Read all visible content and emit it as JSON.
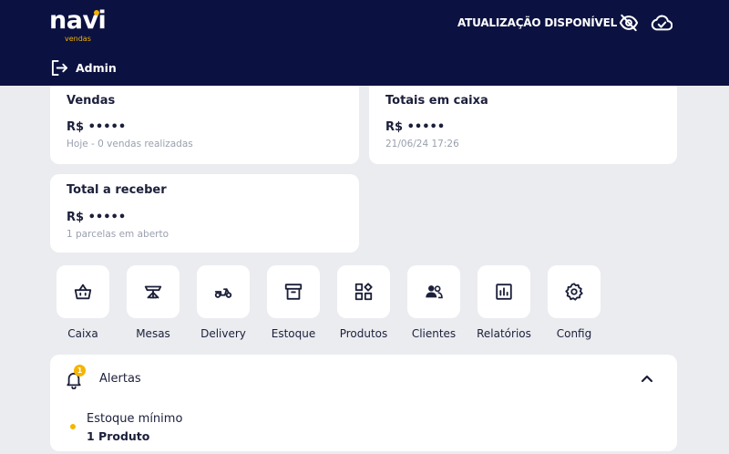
{
  "header": {
    "logo_main": "navi",
    "logo_sub": "vendas",
    "update_label": "ATUALIZAÇÃO DISPONÍVEL",
    "user_name": "Admin",
    "icons": [
      "eye-off-icon",
      "cloud-check-icon",
      "logout-icon"
    ],
    "colors": {
      "background": "#0b1140",
      "accent": "#f2b200"
    }
  },
  "cards": {
    "vendas": {
      "title": "Vendas",
      "value": "R$ •••••",
      "sub": "Hoje - 0 vendas realizadas"
    },
    "caixa": {
      "title": "Totais em caixa",
      "value": "R$ •••••",
      "sub": "21/06/24 17:26"
    },
    "receber": {
      "title": "Total a receber",
      "value": "R$ •••••",
      "sub": "1 parcelas em aberto"
    }
  },
  "shortcuts": [
    {
      "label": "Caixa",
      "icon": "basket-icon"
    },
    {
      "label": "Mesas",
      "icon": "table-icon"
    },
    {
      "label": "Delivery",
      "icon": "scooter-icon"
    },
    {
      "label": "Estoque",
      "icon": "archive-box-icon"
    },
    {
      "label": "Produtos",
      "icon": "grid-add-icon"
    },
    {
      "label": "Clientes",
      "icon": "people-icon"
    },
    {
      "label": "Relatórios",
      "icon": "report-icon"
    },
    {
      "label": "Config",
      "icon": "gear-icon"
    }
  ],
  "alerts": {
    "title": "Alertas",
    "badge_count": "1",
    "items": [
      {
        "name": "Estoque mínimo",
        "count": "1 Produto"
      }
    ],
    "colors": {
      "badge": "#f5b400"
    }
  }
}
